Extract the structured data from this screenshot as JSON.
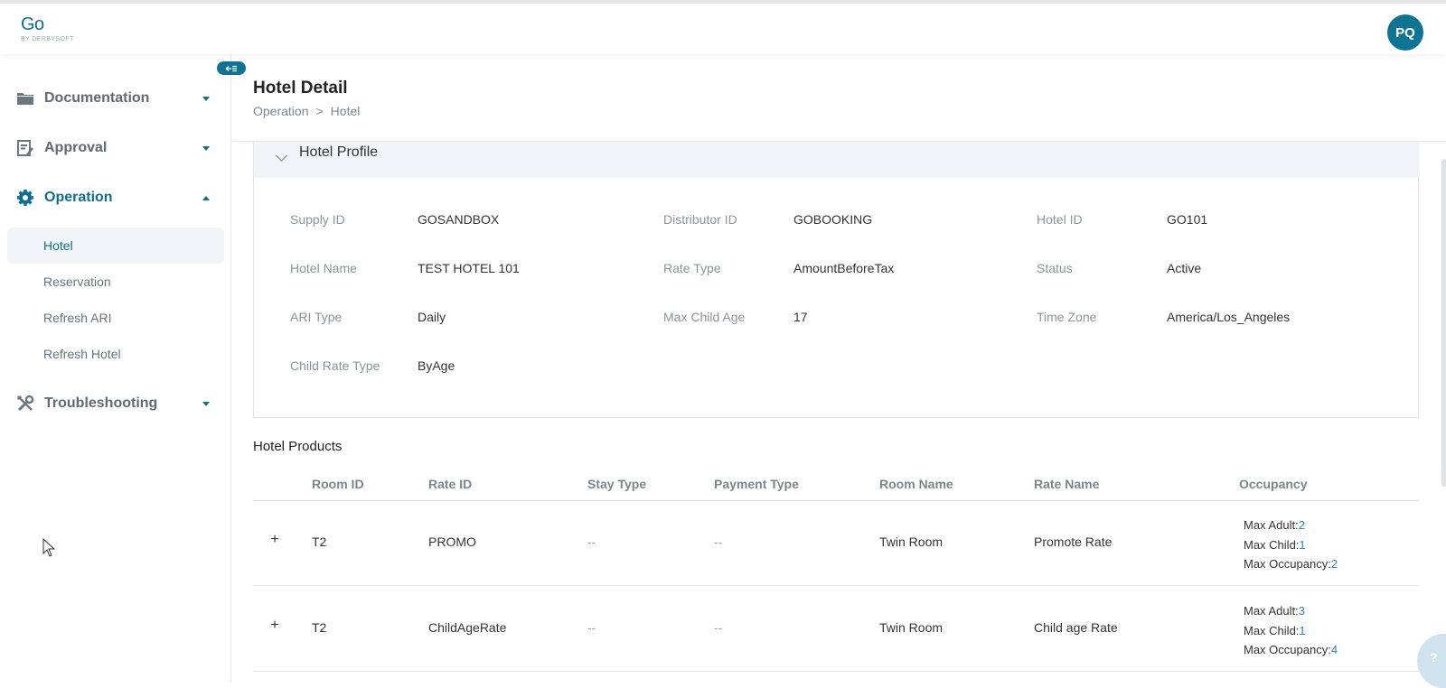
{
  "header": {
    "logo_main": "Go",
    "logo_sub": "BY DERBYSOFT",
    "avatar_initials": "PQ"
  },
  "sidebar": {
    "groups": [
      {
        "label": "Documentation",
        "icon": "folder-icon",
        "expanded": false
      },
      {
        "label": "Approval",
        "icon": "edit-document-icon",
        "expanded": false
      },
      {
        "label": "Operation",
        "icon": "gear-icon",
        "expanded": true
      },
      {
        "label": "Troubleshooting",
        "icon": "tools-icon",
        "expanded": false
      }
    ],
    "operation_items": [
      "Hotel",
      "Reservation",
      "Refresh ARI",
      "Refresh Hotel"
    ],
    "active_item": "Hotel"
  },
  "page": {
    "title": "Hotel Detail",
    "breadcrumb": [
      "Operation",
      ">",
      "Hotel"
    ]
  },
  "profile": {
    "section_title": "Hotel Profile",
    "fields": [
      {
        "label": "Supply ID",
        "value": "GOSANDBOX"
      },
      {
        "label": "Distributor ID",
        "value": "GOBOOKING"
      },
      {
        "label": "Hotel ID",
        "value": "GO101"
      },
      {
        "label": "Hotel Name",
        "value": "TEST HOTEL 101"
      },
      {
        "label": "Rate Type",
        "value": "AmountBeforeTax"
      },
      {
        "label": "Status",
        "value": "Active"
      },
      {
        "label": "ARI Type",
        "value": "Daily"
      },
      {
        "label": "Max Child Age",
        "value": "17"
      },
      {
        "label": "Time Zone",
        "value": "America/Los_Angeles"
      },
      {
        "label": "Child Rate Type",
        "value": "ByAge"
      }
    ]
  },
  "products": {
    "title": "Hotel Products",
    "columns": [
      "Room ID",
      "Rate ID",
      "Stay Type",
      "Payment Type",
      "Room Name",
      "Rate Name",
      "Occupancy"
    ],
    "rows": [
      {
        "expand": "+",
        "room_id": "T2",
        "rate_id": "PROMO",
        "stay_type": "--",
        "payment_type": "--",
        "room_name": "Twin Room",
        "rate_name": "Promote Rate",
        "occ_adult_label": "Max Adult:",
        "occ_adult": "2",
        "occ_child_label": "Max Child:",
        "occ_child": "1",
        "occ_total_label": "Max Occupancy:",
        "occ_total": "2"
      },
      {
        "expand": "+",
        "room_id": "T2",
        "rate_id": "ChildAgeRate",
        "stay_type": "--",
        "payment_type": "--",
        "room_name": "Twin Room",
        "rate_name": "Child age Rate",
        "occ_adult_label": "Max Adult:",
        "occ_adult": "3",
        "occ_child_label": "Max Child:",
        "occ_child": "1",
        "occ_total_label": "Max Occupancy:",
        "occ_total": "4"
      }
    ]
  },
  "colors": {
    "accent": "#0f7394",
    "active_bg": "#f1f5f8",
    "number_link": "#2a86b3"
  }
}
